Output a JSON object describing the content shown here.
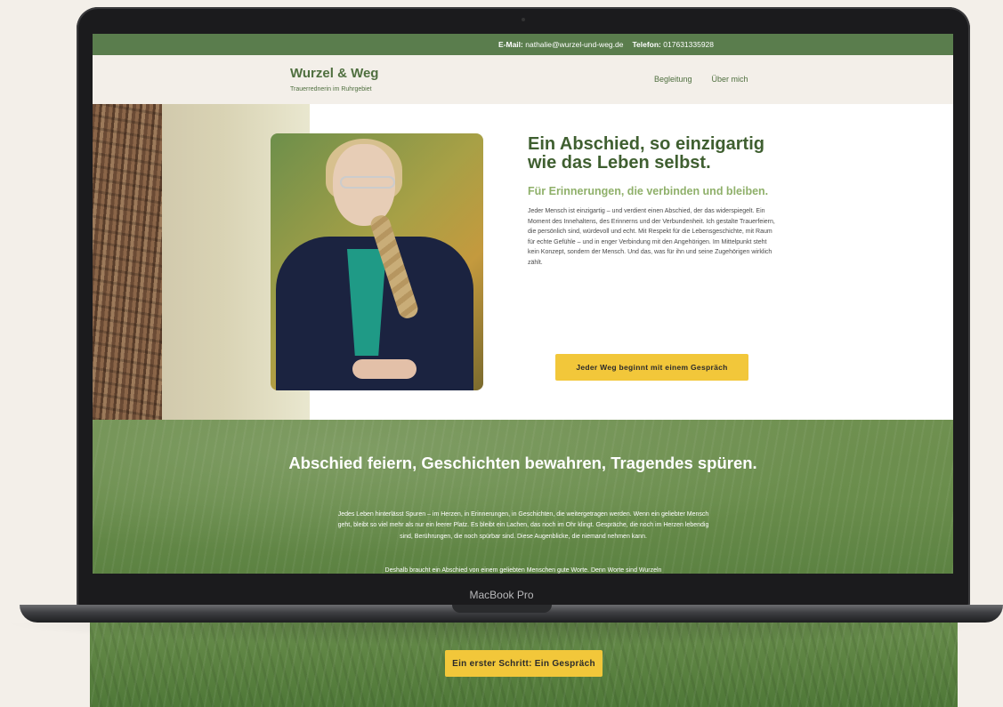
{
  "topbar": {
    "email_label": "E-Mail:",
    "email_value": "nathalie@wurzel-und-weg.de",
    "phone_label": "Telefon:",
    "phone_value": "017631335928"
  },
  "header": {
    "logo_title": "Wurzel & Weg",
    "logo_subtitle": "Trauerrednerin im Ruhrgebiet",
    "nav": [
      "Begleitung",
      "Über mich"
    ]
  },
  "hero": {
    "title": "Ein Abschied, so einzigartig wie das Leben selbst.",
    "subtitle": "Für Erinnerungen, die verbinden und bleiben.",
    "body": "Jeder Mensch ist einzigartig – und verdient einen Abschied, der das widerspiegelt. Ein Moment des Innehaltens, des Erinnerns und der Verbundenheit. Ich gestalte Trauerfeiern, die persönlich sind, würdevoll und echt. Mit Respekt für die Lebensgeschichte, mit Raum für echte Gefühle – und in enger Verbindung mit den Angehörigen. Im Mittelpunkt steht kein Konzept, sondern der Mensch. Und das, was für ihn und seine Zugehörigen wirklich zählt.",
    "cta": "Jeder Weg beginnt mit einem Gespräch"
  },
  "section2": {
    "title": "Abschied feiern, Geschichten bewahren, Tragendes spüren.",
    "body": "Jedes Leben hinterlässt Spuren – im Herzen, in Erinnerungen, in Geschichten, die weitergetragen werden. Wenn ein geliebter Mensch geht, bleibt so viel mehr als nur ein leerer Platz. Es bleibt ein Lachen, das noch im Ohr klingt. Gespräche, die noch im Herzen lebendig sind, Berührungen, die noch spürbar sind. Diese Augenblicke, die niemand nehmen kann.",
    "body2": "Deshalb braucht ein Abschied von einem geliebten Menschen gute Worte. Denn Worte sind Wurzeln"
  },
  "device_label": "MacBook Pro",
  "below": {
    "cta": "Ein erster Schritt: Ein Gespräch"
  }
}
